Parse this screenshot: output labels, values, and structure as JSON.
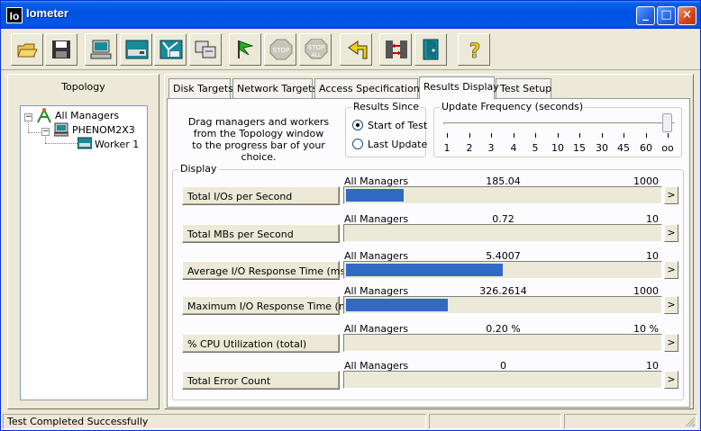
{
  "window": {
    "app_icon_text": "Io",
    "title": "Iometer",
    "controls": [
      "_",
      "□",
      "×"
    ]
  },
  "toolbar": {
    "buttons": [
      {
        "name": "open-icon"
      },
      {
        "name": "save-icon"
      },
      {
        "name": "new-manager-icon"
      },
      {
        "name": "new-disk-worker-icon"
      },
      {
        "name": "new-network-worker-icon"
      },
      {
        "name": "duplicate-worker-icon"
      },
      {
        "name": "start-flag-icon"
      },
      {
        "name": "stop-icon",
        "text": "STOP"
      },
      {
        "name": "stop-all-icon",
        "text": "STOP",
        "text2": "ALL"
      },
      {
        "name": "reset-workers-icon"
      },
      {
        "name": "disconnect-managers-icon"
      },
      {
        "name": "exit-icon"
      },
      {
        "name": "help-icon",
        "text": "?"
      }
    ]
  },
  "topology": {
    "title": "Topology",
    "tree": {
      "root": "All Managers",
      "manager": "PHENOM2X3",
      "worker": "Worker 1"
    }
  },
  "tabs": [
    {
      "label": "Disk Targets"
    },
    {
      "label": "Network Targets"
    },
    {
      "label": "Access Specifications"
    },
    {
      "label": "Results Display"
    },
    {
      "label": "Test Setup"
    }
  ],
  "drag_text": [
    "Drag managers and workers",
    "from the Topology window",
    "to the progress bar of your choice."
  ],
  "results_since": {
    "title": "Results Since",
    "options": [
      "Start of Test",
      "Last Update"
    ],
    "selected": "Start of Test"
  },
  "update_frequency": {
    "title": "Update Frequency (seconds)",
    "ticks": [
      "1",
      "2",
      "3",
      "4",
      "5",
      "10",
      "15",
      "30",
      "45",
      "60",
      "oo"
    ],
    "selected": "oo"
  },
  "display": {
    "title": "Display",
    "rows": [
      {
        "label": "Total I/Os per Second",
        "source": "All Managers",
        "value": "185.04",
        "max": "1000",
        "fill": 0.185
      },
      {
        "label": "Total MBs per Second",
        "source": "All Managers",
        "value": "0.72",
        "max": "10",
        "fill": 0.0
      },
      {
        "label": "Average I/O Response Time (ms)",
        "source": "All Managers",
        "value": "5.4007",
        "max": "10",
        "fill": 0.5
      },
      {
        "label": "Maximum I/O Response Time (ms)",
        "source": "All Managers",
        "value": "326.2614",
        "max": "1000",
        "fill": 0.326
      },
      {
        "label": "% CPU Utilization (total)",
        "source": "All Managers",
        "value": "0.20 %",
        "max": "10 %",
        "fill": 0.0
      },
      {
        "label": "Total Error Count",
        "source": "All Managers",
        "value": "0",
        "max": "10",
        "fill": 0.0
      }
    ],
    "arrow": ">"
  },
  "status_bar": {
    "message": "Test Completed Successfully"
  }
}
